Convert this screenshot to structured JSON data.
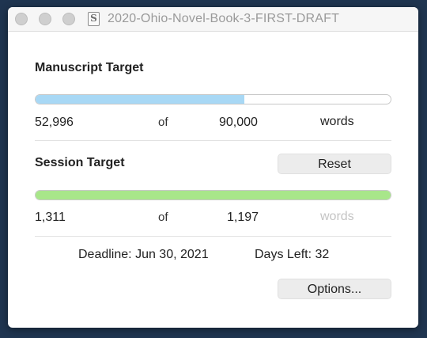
{
  "window": {
    "title": "2020-Ohio-Novel-Book-3-FIRST-DRAFT",
    "doc_icon_letter": "S"
  },
  "manuscript": {
    "heading": "Manuscript Target",
    "current": "52,996",
    "of": "of",
    "target": "90,000",
    "unit": "words",
    "progress": 0.5888,
    "bar_color": "#a8d8f5"
  },
  "session": {
    "heading": "Session Target",
    "reset_label": "Reset",
    "current": "1,311",
    "of": "of",
    "target": "1,197",
    "unit": "words",
    "progress": 1.0,
    "bar_color": "#a8e68a"
  },
  "deadline": {
    "label": "Deadline:",
    "date": "Jun 30, 2021",
    "days_left_label": "Days Left:",
    "days_left": "32"
  },
  "options_label": "Options..."
}
